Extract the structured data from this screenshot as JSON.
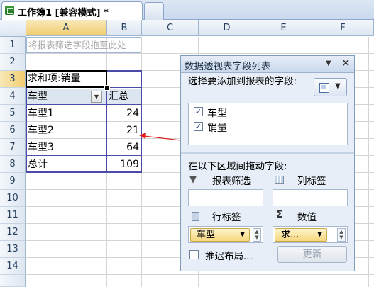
{
  "window": {
    "tab_title": "工作簿1  [兼容模式] *"
  },
  "grid": {
    "columns": [
      "A",
      "B",
      "C",
      "D",
      "E",
      "F"
    ],
    "rows": [
      "1",
      "2",
      "3",
      "4",
      "5",
      "6",
      "7",
      "8",
      "9",
      "10",
      "11",
      "12",
      "13",
      "14"
    ],
    "hint_text": "将报表筛选字段拖至此处"
  },
  "pivot_table": {
    "value_header": "求和项:销量",
    "row_label_header": "车型",
    "total_header": "汇总",
    "rows": [
      {
        "label": "车型1",
        "value": "24"
      },
      {
        "label": "车型2",
        "value": "21"
      },
      {
        "label": "车型3",
        "value": "64"
      }
    ],
    "grand_total": {
      "label": "总计",
      "value": "109"
    }
  },
  "field_list": {
    "title": "数据透视表字段列表",
    "choose_text": "选择要添加到报表的字段:",
    "fields": [
      {
        "label": "车型",
        "checked": "✓"
      },
      {
        "label": "销量",
        "checked": "✓"
      }
    ],
    "drag_text": "在以下区域间拖动字段:",
    "report_filter_label": "报表筛选",
    "column_labels_label": "列标签",
    "row_labels_label": "行标签",
    "values_label": "数值",
    "row_item": "车型",
    "value_item": "求...",
    "defer_label": "推迟布局...",
    "update_button": "更新"
  },
  "annotation": {
    "color": "#e02020"
  }
}
